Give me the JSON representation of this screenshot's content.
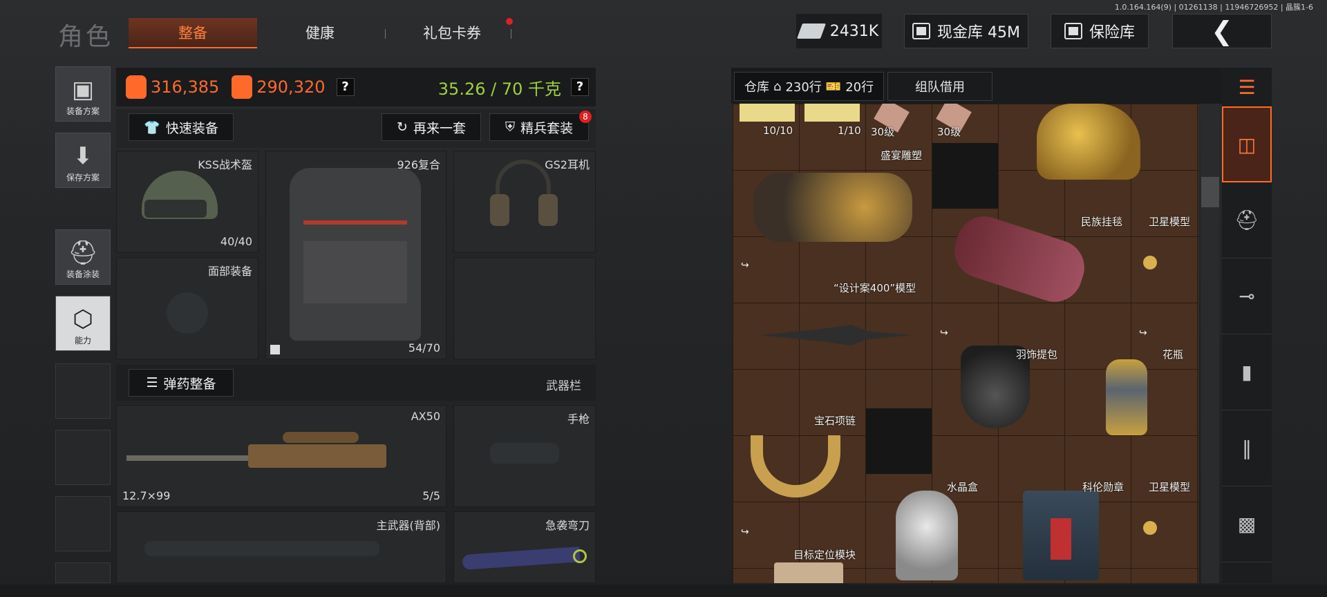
{
  "version": "1.0.164.164(9) | 01261138 | 11946726952 | 晶簇1-6",
  "header": {
    "title": "角色",
    "tabs": [
      {
        "label": "整备",
        "active": true
      },
      {
        "label": "健康",
        "active": false
      },
      {
        "label": "礼包卡券",
        "active": false,
        "notify": true
      }
    ],
    "cash": "2431K",
    "cash_vault": "现金库 45M",
    "safe": "保险库"
  },
  "sidebar": {
    "items": [
      {
        "label": "装备方案",
        "icon": "vest-icon"
      },
      {
        "label": "保存方案",
        "icon": "download-icon"
      },
      {
        "label": "装备涂装",
        "icon": "helmet-paint-icon"
      },
      {
        "label": "能力",
        "icon": "ability-icon"
      }
    ]
  },
  "stats": {
    "value1": "316,385",
    "value2": "290,320",
    "weight": "35.26 / 70 千克",
    "help": "?"
  },
  "actions": {
    "quick_equip": "快速装备",
    "again": "再来一套",
    "elite": "精兵套装",
    "elite_badge": "8",
    "ammo": "弹药整备",
    "weapon_bar": "武器栏"
  },
  "slots": {
    "helmet": {
      "name": "KSS战术盔",
      "count": "40/40"
    },
    "armor": {
      "name": "926复合",
      "count": "54/70"
    },
    "headset": {
      "name": "GS2耳机"
    },
    "face": {
      "name": "面部装备"
    },
    "primary": {
      "name": "AX50",
      "caliber": "12.7×99",
      "ammo": "5/5"
    },
    "pistol": {
      "name": "手枪"
    },
    "backup": {
      "name": "主武器(背部)"
    },
    "melee": {
      "name": "急袭弯刀"
    }
  },
  "warehouse": {
    "tab": "仓库",
    "rows": "230行",
    "extra_rows": "20行",
    "team": "组队借用",
    "items": [
      {
        "label": "10/10"
      },
      {
        "label": "1/10"
      },
      {
        "label": "30级"
      },
      {
        "label": "30级"
      },
      {
        "label": "盛宴雕塑"
      },
      {
        "label": "民族挂毯"
      },
      {
        "label": "卫星模型"
      },
      {
        "label": "“设计案400”模型"
      },
      {
        "label": "羽饰提包"
      },
      {
        "label": "花瓶"
      },
      {
        "label": "宝石项链"
      },
      {
        "label": "水晶盒"
      },
      {
        "label": "科伦勋章"
      },
      {
        "label": "卫星模型"
      },
      {
        "label": "目标定位模块"
      }
    ]
  },
  "colors": {
    "accent": "#ff6a2a",
    "weight_ok": "#9fd23b",
    "warehouse_bg": "#4a3020"
  }
}
